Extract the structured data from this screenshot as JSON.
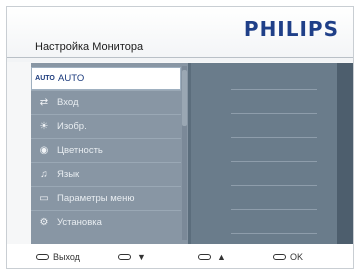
{
  "header": {
    "brand": "PHILIPS",
    "title": "Настройка Монитора"
  },
  "menu": {
    "items": [
      {
        "icon": "AUTO",
        "label": "AUTO",
        "selected": true
      },
      {
        "icon": "⇄",
        "label": "Вход"
      },
      {
        "icon": "☀",
        "label": "Изобр."
      },
      {
        "icon": "◉",
        "label": "Цветность"
      },
      {
        "icon": "♫",
        "label": "Язык"
      },
      {
        "icon": "▭",
        "label": "Параметры меню"
      },
      {
        "icon": "⚙",
        "label": "Установка"
      }
    ]
  },
  "footer": {
    "buttons": [
      {
        "label": "Выход",
        "symbol": ""
      },
      {
        "label": "",
        "symbol": "▼"
      },
      {
        "label": "",
        "symbol": "▲"
      },
      {
        "label": "OK",
        "symbol": ""
      }
    ]
  }
}
